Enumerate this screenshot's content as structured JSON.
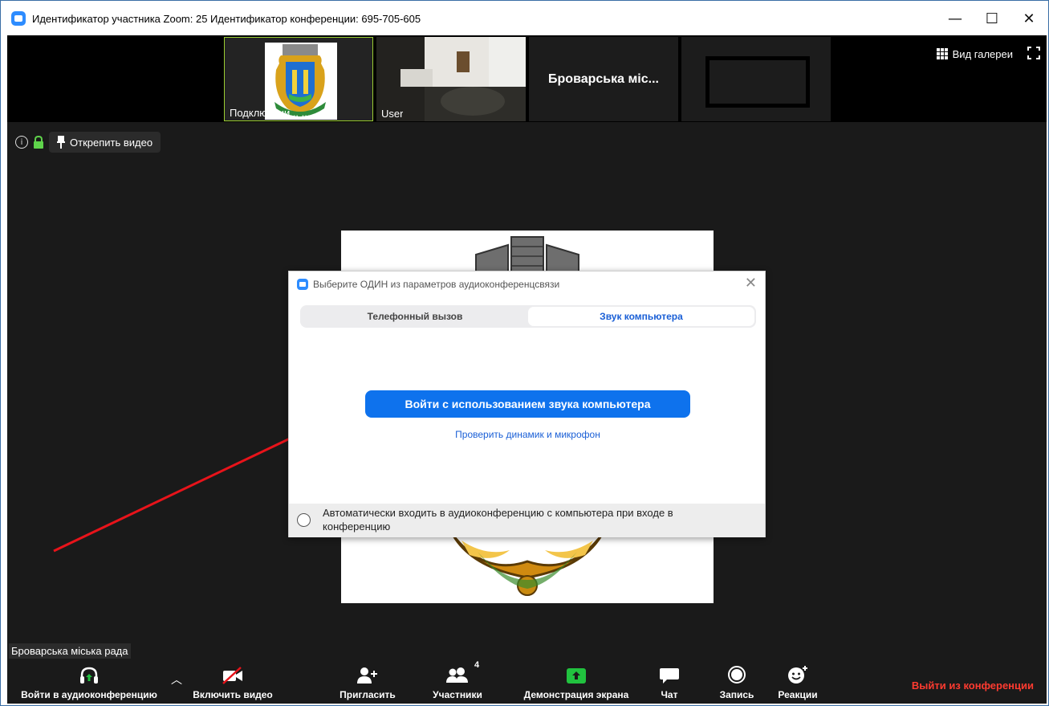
{
  "window": {
    "title": "Идентификатор участника Zoom: 25  Идентификатор конференции: 695-705-605",
    "minimize": "—",
    "maximize": "☐",
    "close": "✕"
  },
  "strip": {
    "thumbs": [
      {
        "label": "Подключени... ..."
      },
      {
        "label": "User"
      },
      {
        "name": "Броварська міс..."
      },
      {
        "name": ""
      }
    ],
    "gallery_view_label": "Вид галереи"
  },
  "infobar": {
    "unpin_label": "Открепить видео"
  },
  "dialog": {
    "title": "Выберите ОДИН из параметров аудиоконференцсвязи",
    "close": "✕",
    "tab_phone": "Телефонный вызов",
    "tab_computer": "Звук компьютера",
    "join_button": "Войти с использованием звука компьютера",
    "test_link": "Проверить динамик и микрофон",
    "auto_join_label": "Автоматически входить в аудиоконференцию с компьютера при входе в конференцию",
    "auto_join_checked": false
  },
  "speaker_label": "Броварська міська рада",
  "toolbar": {
    "join_audio": "Войти в аудиоконференцию",
    "start_video": "Включить видео",
    "invite": "Пригласить",
    "participants": "Участники",
    "participants_count": "4",
    "share_screen": "Демонстрация экрана",
    "chat": "Чат",
    "record": "Запись",
    "reactions": "Реакции",
    "leave": "Выйти из конференции"
  },
  "colors": {
    "accent": "#0e72ed",
    "leave": "#ff3b30",
    "share": "#21c23f",
    "annotation_arrow": "#e8131a"
  }
}
